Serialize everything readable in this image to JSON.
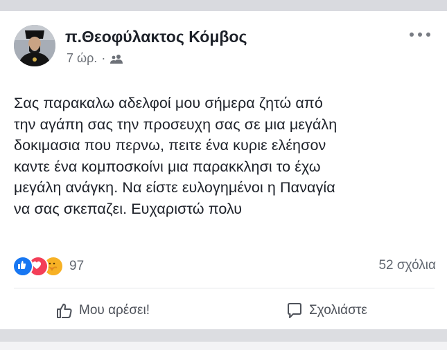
{
  "post": {
    "author": "π.Θεοφύλακτος Κόμβος",
    "time": "7 ώρ.",
    "separator": "·",
    "audience_icon": "friends-icon",
    "text": "Σας παρακαλω αδελφοί μου σήμερα ζητώ από\nτην αγάπη σας την προσευχη σας σε μια μεγάλη\nδοκιμασια που περνω, πειτε ένα κυριε ελέησον\nκαντε ένα κομποσκοίνι μια παρακκλησι το έχω\nμεγάλη ανάγκη. Να είστε ευλογημένοι η Παναγία\nνα σας σκεπαζει. Ευχαριστώ πολυ"
  },
  "reactions": {
    "types": [
      "like-icon",
      "love-icon",
      "care-icon"
    ],
    "count": "97",
    "comments": "52 σχόλια"
  },
  "actions": {
    "like_label": "Μου αρέσει!",
    "comment_label": "Σχολιάστε"
  },
  "colors": {
    "like": "#1877f2",
    "love": "#f33e58",
    "care": "#f7b125",
    "text": "#1d2129",
    "muted": "#616770"
  }
}
